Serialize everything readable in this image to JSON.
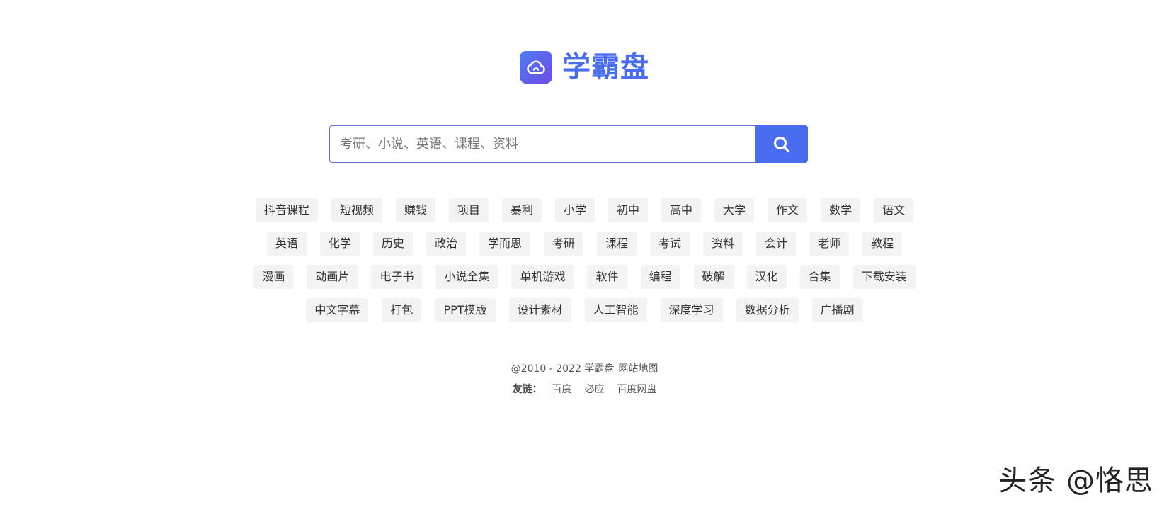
{
  "logo": {
    "text": "学霸盘",
    "icon": "cloud-icon",
    "colors": {
      "brand": "#4a6cf0",
      "gradient_start": "#4d7cf3",
      "gradient_end": "#6e4be8"
    }
  },
  "search": {
    "placeholder": "考研、小说、英语、课程、资料",
    "value": "",
    "button_icon": "search-icon",
    "button_color": "#4a6cf0"
  },
  "tags": {
    "rows": [
      [
        "抖音课程",
        "短视频",
        "赚钱",
        "项目",
        "暴利",
        "小学",
        "初中",
        "高中",
        "大学",
        "作文",
        "数学",
        "语文"
      ],
      [
        "英语",
        "化学",
        "历史",
        "政治",
        "学而思",
        "考研",
        "课程",
        "考试",
        "资料",
        "会计",
        "老师",
        "教程"
      ],
      [
        "漫画",
        "动画片",
        "电子书",
        "小说全集",
        "单机游戏",
        "软件",
        "编程",
        "破解",
        "汉化",
        "合集",
        "下载安装"
      ],
      [
        "中文字幕",
        "打包",
        "PPT模版",
        "设计素材",
        "人工智能",
        "深度学习",
        "数据分析",
        "广播剧"
      ]
    ]
  },
  "footer": {
    "copyright": "@2010 - 2022 学霸盘",
    "sitemap": "网站地图",
    "links_label": "友链：",
    "links": [
      "百度",
      "必应",
      "百度网盘"
    ]
  },
  "watermark": "头条 @恪思"
}
